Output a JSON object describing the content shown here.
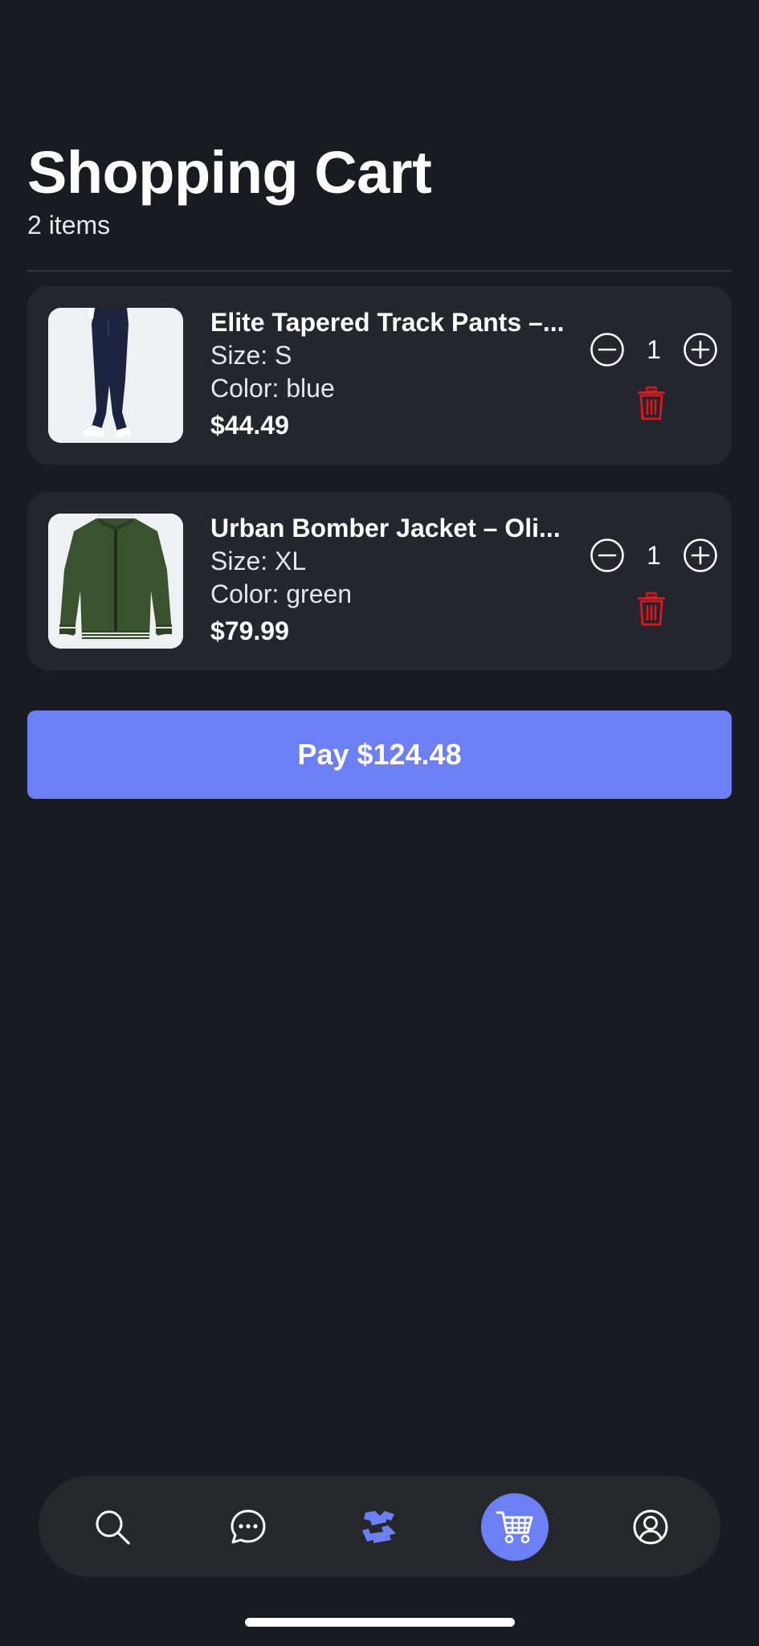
{
  "header": {
    "title": "Shopping Cart",
    "subtitle": "2 items"
  },
  "cart": {
    "items": [
      {
        "name": "Elite Tapered Track Pants –...",
        "size": "Size: S",
        "color": "Color: blue",
        "price": "$44.49",
        "quantity": "1",
        "image_icon": "track-pants-image"
      },
      {
        "name": "Urban Bomber Jacket – Oli...",
        "size": "Size: XL",
        "color": "Color: green",
        "price": "$79.99",
        "quantity": "1",
        "image_icon": "bomber-jacket-image"
      }
    ]
  },
  "checkout": {
    "pay_label": "Pay $124.48"
  },
  "tabbar": {
    "items": [
      {
        "icon": "search-icon",
        "active": false
      },
      {
        "icon": "chat-bubble-icon",
        "active": false
      },
      {
        "icon": "shirt-swap-icon",
        "active": false
      },
      {
        "icon": "cart-icon",
        "active": true
      },
      {
        "icon": "profile-icon",
        "active": false
      }
    ]
  },
  "colors": {
    "background": "#1a1b20",
    "card": "#24252d",
    "accent": "#6d7ff5",
    "delete": "#e0141c",
    "tabbar": "#26272b"
  }
}
